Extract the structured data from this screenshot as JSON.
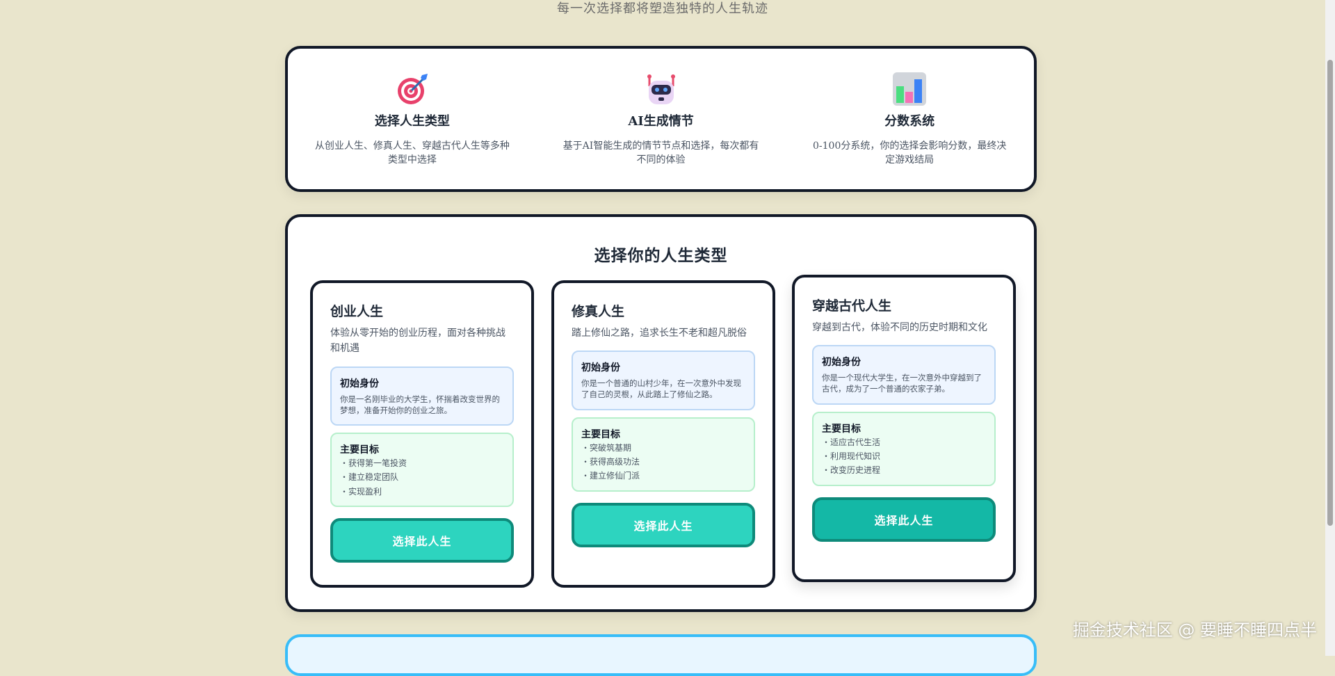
{
  "subtitle": "每一次选择都将塑造独特的人生轨迹",
  "features": [
    {
      "icon": "target-icon",
      "title": "选择人生类型",
      "desc": "从创业人生、修真人生、穿越古代人生等多种类型中选择"
    },
    {
      "icon": "robot-icon",
      "title": "AI生成情节",
      "desc": "基于AI智能生成的情节节点和选择，每次都有不同的体验"
    },
    {
      "icon": "bar-chart-icon",
      "title": "分数系统",
      "desc": "0-100分系统，你的选择会影响分数，最终决定游戏结局"
    }
  ],
  "select": {
    "title": "选择你的人生类型",
    "identity_label": "初始身份",
    "goals_label": "主要目标",
    "button_label": "选择此人生",
    "cards": [
      {
        "title": "创业人生",
        "desc": "体验从零开始的创业历程，面对各种挑战和机遇",
        "identity": "你是一名刚毕业的大学生，怀揣着改变世界的梦想，准备开始你的创业之旅。",
        "goals": [
          "获得第一笔投资",
          "建立稳定团队",
          "实现盈利"
        ]
      },
      {
        "title": "修真人生",
        "desc": "踏上修仙之路，追求长生不老和超凡脱俗",
        "identity": "你是一个普通的山村少年，在一次意外中发现了自己的灵根，从此踏上了修仙之路。",
        "goals": [
          "突破筑基期",
          "获得高级功法",
          "建立修仙门派"
        ]
      },
      {
        "title": "穿越古代人生",
        "desc": "穿越到古代，体验不同的历史时期和文化",
        "identity": "你是一个现代大学生，在一次意外中穿越到了古代，成为了一个普通的农家子弟。",
        "goals": [
          "适应古代生活",
          "利用现代知识",
          "改变历史进程"
        ]
      }
    ]
  },
  "watermark": "掘金技术社区 @ 要睡不睡四点半",
  "colors": {
    "accent": "#2dd4bf",
    "accent_dark": "#14b8a6",
    "background": "#e9e5cc"
  }
}
